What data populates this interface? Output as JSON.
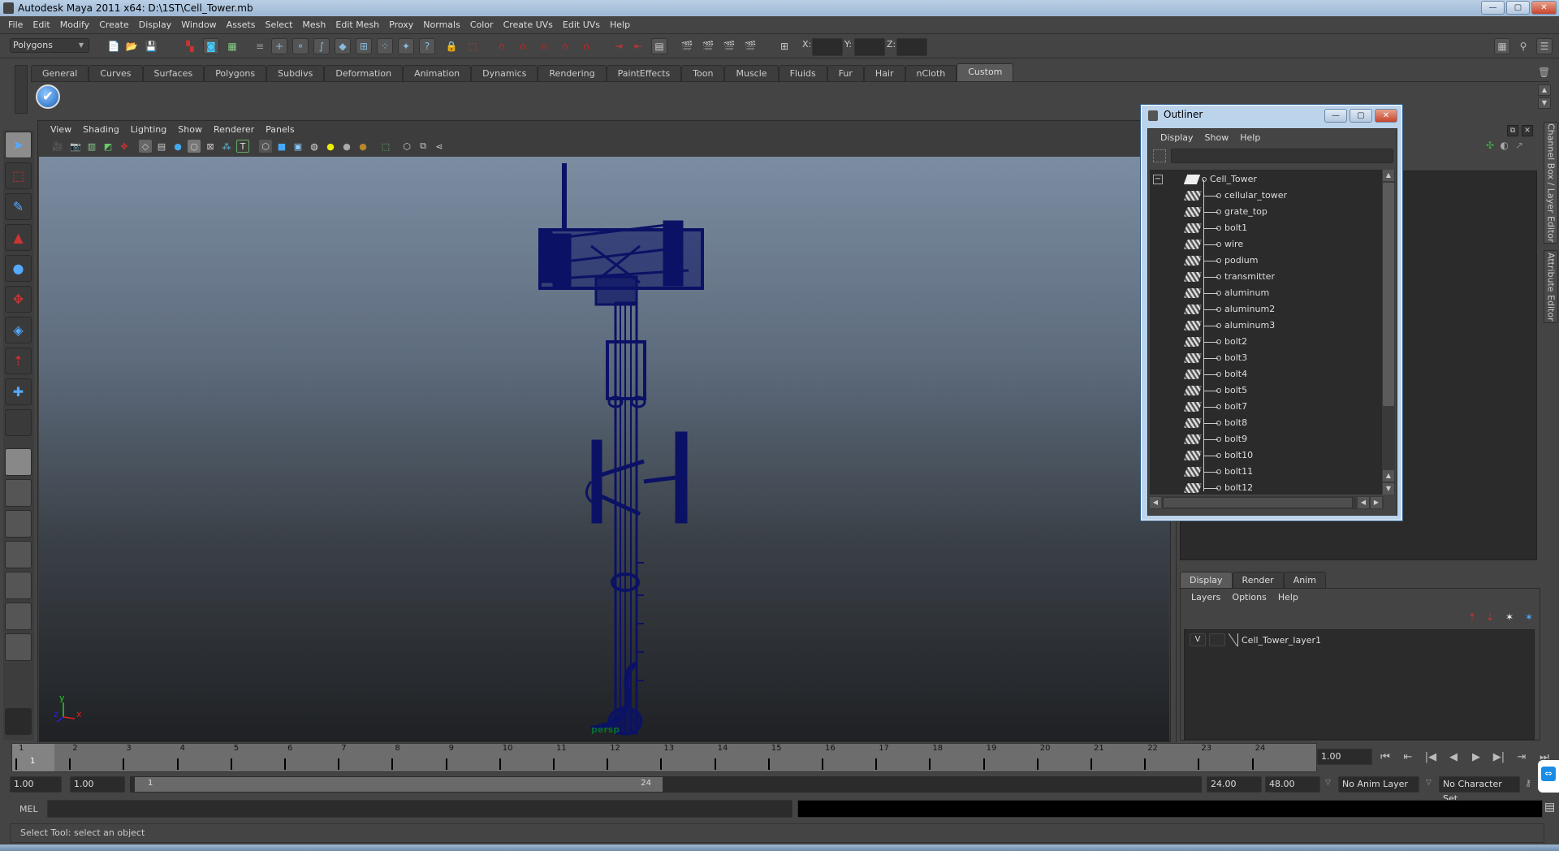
{
  "window": {
    "title": "Autodesk Maya 2011 x64: D:\\1ST\\Cell_Tower.mb",
    "minimize": "—",
    "maximize": "▢",
    "close": "✕"
  },
  "menubar": [
    "File",
    "Edit",
    "Modify",
    "Create",
    "Display",
    "Window",
    "Assets",
    "Select",
    "Mesh",
    "Edit Mesh",
    "Proxy",
    "Normals",
    "Color",
    "Create UVs",
    "Edit UVs",
    "Help"
  ],
  "statusline": {
    "menu_set": "Polygons",
    "x_label": "X:",
    "y_label": "Y:",
    "z_label": "Z:",
    "x_value": "",
    "y_value": "",
    "z_value": ""
  },
  "shelf": {
    "tabs": [
      "General",
      "Curves",
      "Surfaces",
      "Polygons",
      "Subdivs",
      "Deformation",
      "Animation",
      "Dynamics",
      "Rendering",
      "PaintEffects",
      "Toon",
      "Muscle",
      "Fluids",
      "Fur",
      "Hair",
      "nCloth",
      "Custom"
    ],
    "active_tab": "Custom",
    "check_icon": "✔"
  },
  "toolbox": {
    "tools": [
      {
        "name": "select-tool",
        "glyph": "➤",
        "selected": true
      },
      {
        "name": "lasso-tool",
        "glyph": "⬚"
      },
      {
        "name": "paint-select-tool",
        "glyph": "✎"
      },
      {
        "name": "move-tool",
        "glyph": "▲"
      },
      {
        "name": "rotate-tool",
        "glyph": "●"
      },
      {
        "name": "scale-tool",
        "glyph": "✥"
      },
      {
        "name": "universal-manipulator",
        "glyph": "◈"
      },
      {
        "name": "soft-modification-tool",
        "glyph": "⇡"
      },
      {
        "name": "show-manipulator-tool",
        "glyph": "✚"
      },
      {
        "name": "last-tool",
        "glyph": ""
      }
    ],
    "layouts": [
      "single-view",
      "four-view",
      "outliner-persp",
      "persp-graph",
      "hypershade-persp",
      "persp-graph-outliner",
      "more-layouts"
    ]
  },
  "panel": {
    "menu": [
      "View",
      "Shading",
      "Lighting",
      "Show",
      "Renderer",
      "Panels"
    ],
    "camera_label": "persp",
    "axis": {
      "x": "x",
      "y": "y",
      "z": "z"
    }
  },
  "outliner": {
    "title": "Outliner",
    "menu": [
      "Display",
      "Show",
      "Help"
    ],
    "root": "Cell_Tower",
    "items": [
      "cellular_tower",
      "grate_top",
      "bolt1",
      "wire",
      "podium",
      "transmitter",
      "aluminum",
      "aluminum2",
      "aluminum3",
      "bolt2",
      "bolt3",
      "bolt4",
      "bolt5",
      "bolt7",
      "bolt8",
      "bolt9",
      "bolt10",
      "bolt11",
      "bolt12"
    ],
    "collapse_glyph": "−"
  },
  "dock": {
    "vertical_tabs": [
      "Channel Box / Layer Editor",
      "Attribute Editor"
    ],
    "layer_tabs": [
      "Display",
      "Render",
      "Anim"
    ],
    "active_layer_tab": "Display",
    "layer_menu": [
      "Layers",
      "Options",
      "Help"
    ],
    "layers": [
      {
        "visible": "V",
        "name": "Cell_Tower_layer1"
      }
    ]
  },
  "timeline": {
    "frames": [
      1,
      2,
      3,
      4,
      5,
      6,
      7,
      8,
      9,
      10,
      11,
      12,
      13,
      14,
      15,
      16,
      17,
      18,
      19,
      20,
      21,
      22,
      23,
      24
    ],
    "current_frame": "1",
    "current_time_field": "1.00",
    "playback_glyphs": [
      "⏮",
      "⇤",
      "|◀",
      "◀",
      "▶",
      "▶|",
      "⇥",
      "⏭"
    ]
  },
  "range": {
    "start_time": "1.00",
    "playback_start": "1.00",
    "slider_start_label": "1",
    "slider_end_label": "24",
    "playback_end": "24.00",
    "end_time": "48.00",
    "anim_layer": "No Anim Layer",
    "character_set": "No Character Set"
  },
  "command_line": {
    "label": "MEL",
    "input": "",
    "output": ""
  },
  "help_line": "Select Tool: select an object",
  "colors": {
    "accent": "#1c6fd0",
    "wire": "#0b1265",
    "camera_label": "#0e6b2b",
    "close_btn": "#c8452e"
  }
}
